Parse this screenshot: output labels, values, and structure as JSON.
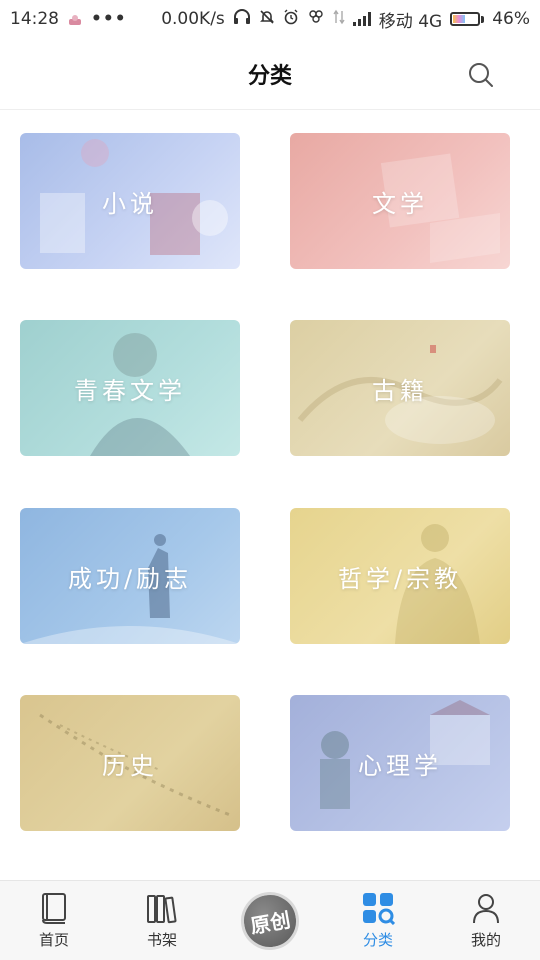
{
  "status_bar": {
    "time": "14:28",
    "dots": "•••",
    "network_speed": "0.00K/s",
    "carrier": "移动 4G",
    "battery": "46%",
    "battery_level": 0.46,
    "icons": [
      "headphones-icon",
      "mute-icon",
      "alarm-icon",
      "clover-icon",
      "data-arrows-icon",
      "signal-icon",
      "battery-icon"
    ]
  },
  "header": {
    "title": "分类",
    "search_icon": "search-icon"
  },
  "categories": [
    {
      "label": "小说"
    },
    {
      "label": "文学"
    },
    {
      "label": "青春文学"
    },
    {
      "label": "古籍"
    },
    {
      "label": "成功/励志"
    },
    {
      "label": "哲学/宗教"
    },
    {
      "label": "历史"
    },
    {
      "label": "心理学"
    }
  ],
  "bottom_nav": {
    "items": [
      {
        "label": "首页",
        "icon": "book-icon"
      },
      {
        "label": "书架",
        "icon": "bookshelf-icon"
      },
      {
        "label": "原创",
        "icon": "original-badge-icon"
      },
      {
        "label": "分类",
        "icon": "category-grid-icon",
        "active": true
      },
      {
        "label": "我的",
        "icon": "person-icon"
      }
    ],
    "active_color": "#2f8de4"
  }
}
